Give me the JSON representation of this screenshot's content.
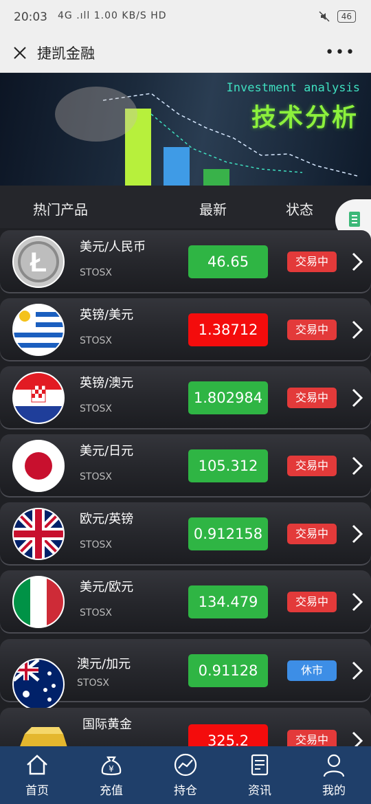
{
  "status_bar": {
    "time": "20:03",
    "network": "4G .ıll 1.00 KB/S HD",
    "battery": "46"
  },
  "title_bar": {
    "title": "捷凯金融",
    "more": "•••"
  },
  "banner": {
    "en": "Investment analysis",
    "zh": "技术分析"
  },
  "list_header": {
    "product": "热门产品",
    "latest": "最新",
    "status": "状态"
  },
  "rows": [
    {
      "name": "美元/人民币",
      "code": "STOSX",
      "price": "46.65",
      "direction": "up",
      "status": "交易中",
      "flag": "litecoin-icon"
    },
    {
      "name": "英镑/美元",
      "code": "STOSX",
      "price": "1.38712",
      "direction": "down",
      "status": "交易中",
      "flag": "uruguay-flag-icon"
    },
    {
      "name": "英镑/澳元",
      "code": "STOSX",
      "price": "1.802984",
      "direction": "up",
      "status": "交易中",
      "flag": "croatia-flag-icon"
    },
    {
      "name": "美元/日元",
      "code": "STOSX",
      "price": "105.312",
      "direction": "up",
      "status": "交易中",
      "flag": "japan-flag-icon"
    },
    {
      "name": "欧元/英镑",
      "code": "STOSX",
      "price": "0.912158",
      "direction": "up",
      "status": "交易中",
      "flag": "uk-flag-icon"
    },
    {
      "name": "美元/欧元",
      "code": "STOSX",
      "price": "134.479",
      "direction": "up",
      "status": "交易中",
      "flag": "italy-flag-icon"
    },
    {
      "name": "澳元/加元",
      "code": "STOSX",
      "price": "0.91128",
      "direction": "up",
      "status": "休市",
      "flag": "australia-flag-icon"
    },
    {
      "name": "国际黄金",
      "code": "",
      "price": "325.2",
      "direction": "down",
      "status": "交易中",
      "flag": "gold-bar-icon"
    }
  ],
  "bottom_nav": [
    {
      "label": "首页",
      "icon": "home-icon"
    },
    {
      "label": "充值",
      "icon": "money-bag-icon"
    },
    {
      "label": "持仓",
      "icon": "chart-icon"
    },
    {
      "label": "资讯",
      "icon": "news-icon"
    },
    {
      "label": "我的",
      "icon": "user-icon"
    }
  ],
  "colors": {
    "up": "#2fb544",
    "down": "#f40c0c",
    "trade": "#e33a3a",
    "rest": "#3d8ee6",
    "nav": "#1f3f6a"
  }
}
